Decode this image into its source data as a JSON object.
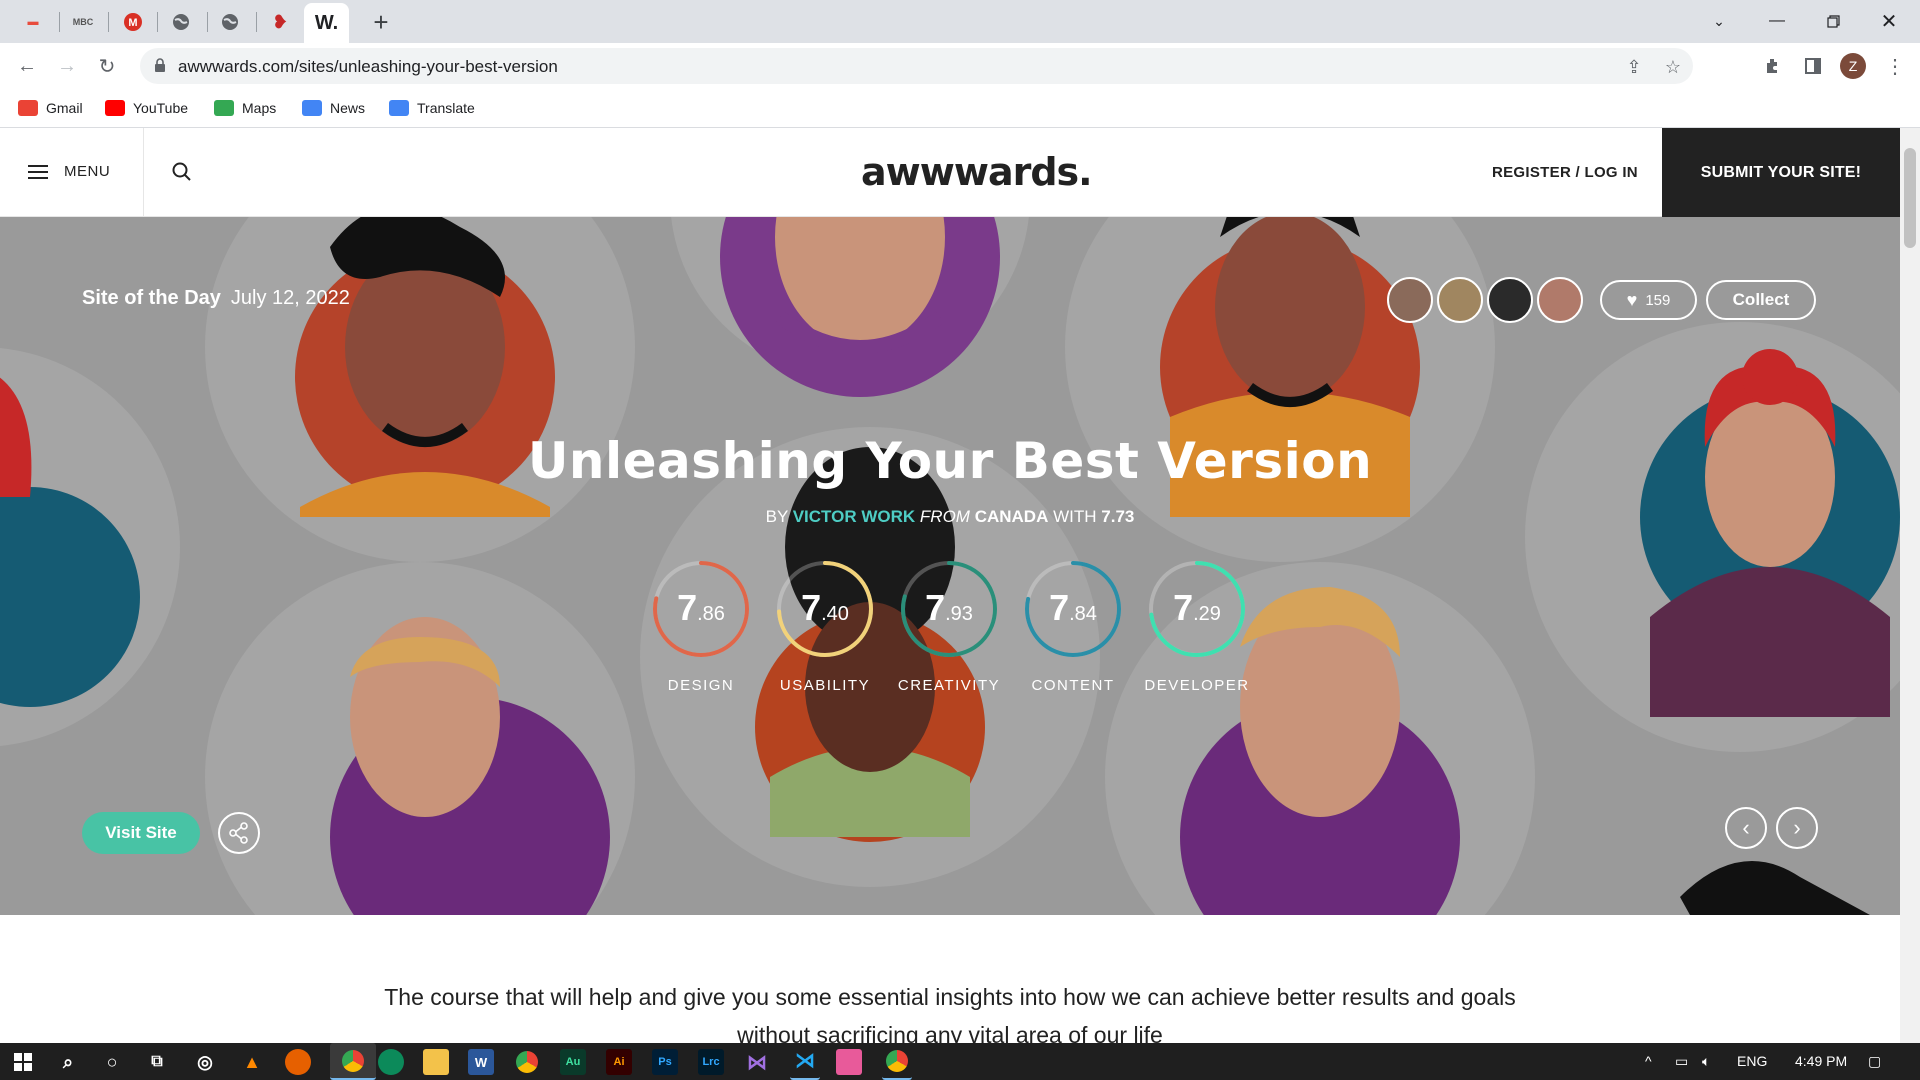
{
  "browser": {
    "active_tab_label": "W.",
    "url": "awwwards.com/sites/unleashing-your-best-version",
    "profile_initial": "Z",
    "bookmarks": [
      {
        "label": "Gmail",
        "color": "#ea4335"
      },
      {
        "label": "YouTube",
        "color": "#ff0000"
      },
      {
        "label": "Maps",
        "color": "#34a853"
      },
      {
        "label": "News",
        "color": "#4285f4"
      },
      {
        "label": "Translate",
        "color": "#4285f4"
      }
    ]
  },
  "header": {
    "menu_label": "MENU",
    "logo": "awwwards.",
    "register_label": "REGISTER / LOG IN",
    "submit_label": "SUBMIT YOUR SITE!"
  },
  "hero": {
    "badge": "Site of the Day",
    "date": "July 12, 2022",
    "likes": "159",
    "collect_label": "Collect",
    "title": "Unleashing Your Best Version",
    "by_prefix": "BY",
    "author": "VICTOR WORK",
    "from_label": "FROM",
    "country": "CANADA",
    "with_label": "WITH",
    "total_score": "7.73",
    "scores": [
      {
        "int": "7",
        "dec": ".86",
        "label": "DESIGN",
        "color": "#e0674a",
        "progress": 0.786
      },
      {
        "int": "7",
        "dec": ".40",
        "label": "USABILITY",
        "color": "#f2d27a",
        "progress": 0.74
      },
      {
        "int": "7",
        "dec": ".93",
        "label": "CREATIVITY",
        "color": "#2a8f7a",
        "progress": 0.793
      },
      {
        "int": "7",
        "dec": ".84",
        "label": "CONTENT",
        "color": "#2a8fa8",
        "progress": 0.784
      },
      {
        "int": "7",
        "dec": ".29",
        "label": "DEVELOPER",
        "color": "#3fe0b0",
        "progress": 0.729
      }
    ],
    "visit_label": "Visit Site"
  },
  "description": "The course that will help and give you some essential insights into how we can achieve better results and goals without sacrificing any vital area of our life",
  "taskbar": {
    "language": "ENG",
    "time": "4:49 PM"
  }
}
